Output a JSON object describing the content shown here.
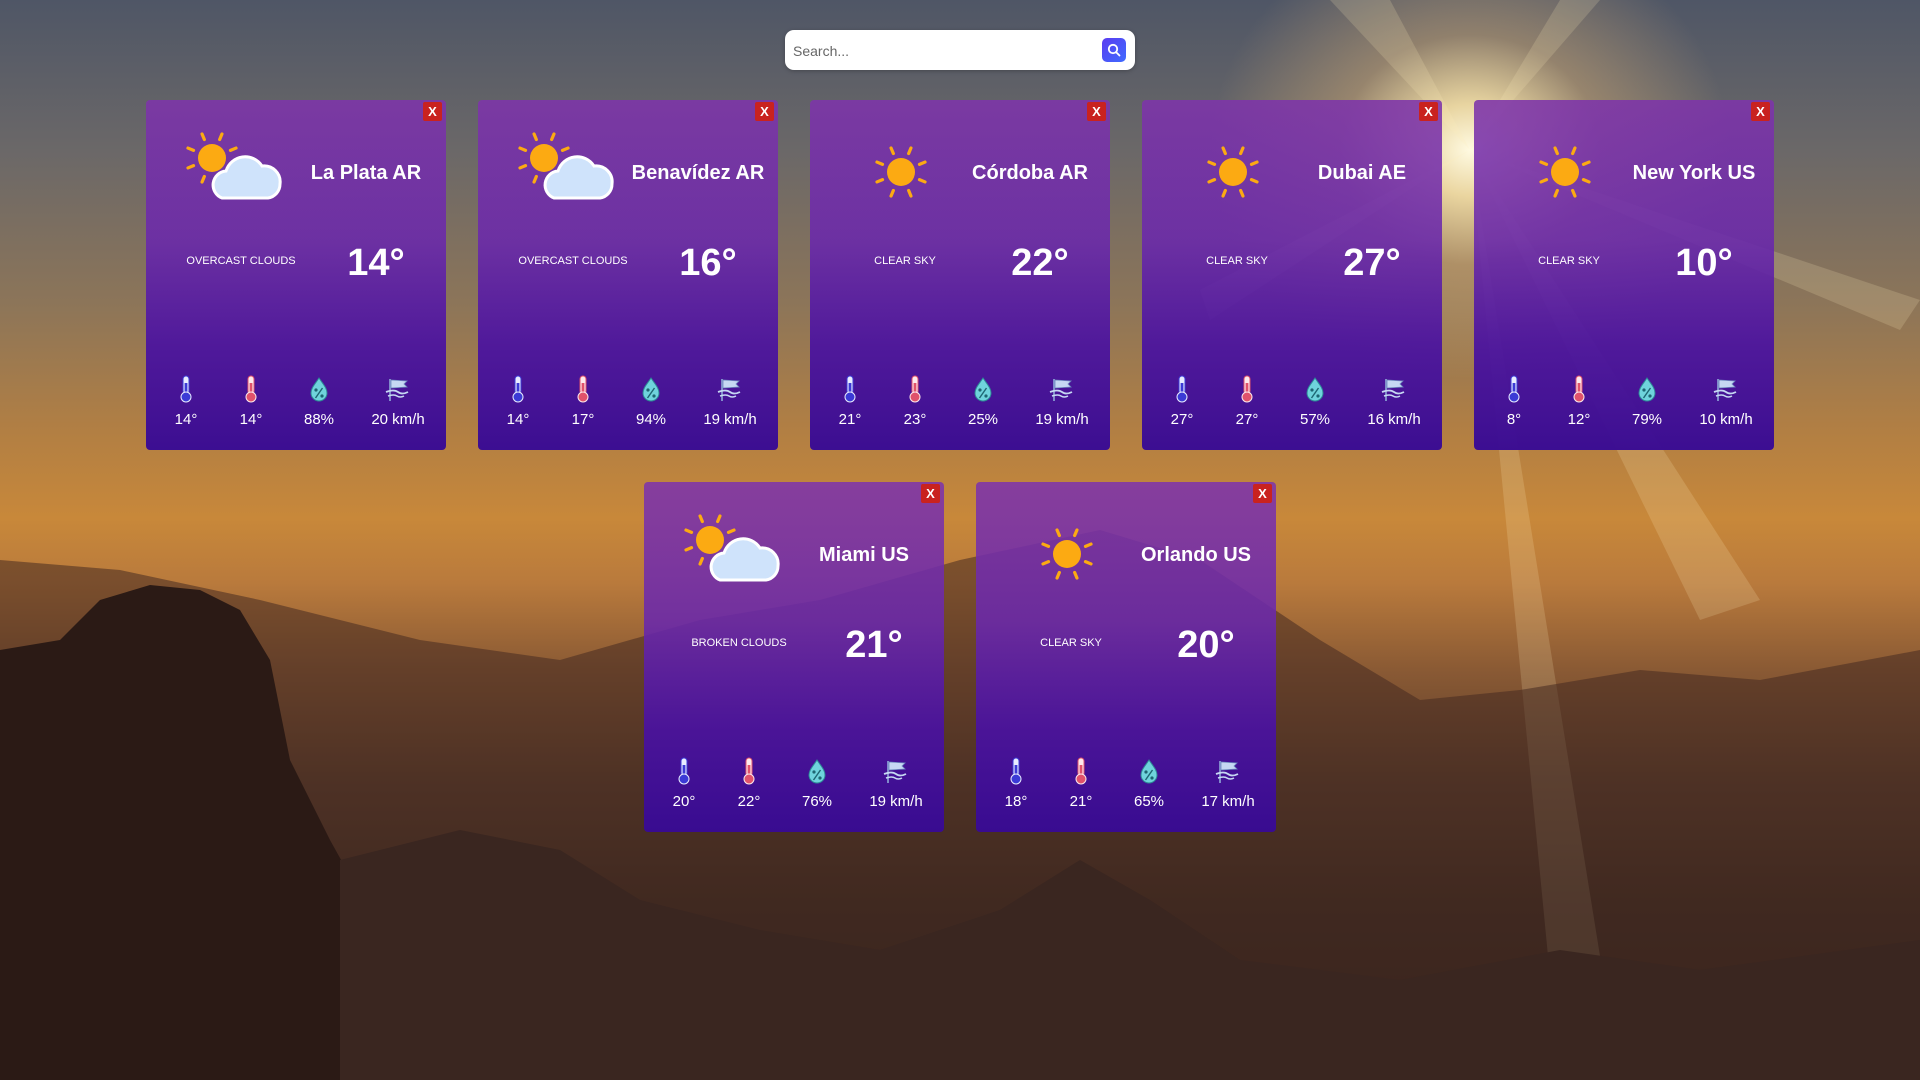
{
  "search": {
    "placeholder": "Search..."
  },
  "cards": [
    {
      "city": "La Plata AR",
      "description": "OVERCAST CLOUDS",
      "temp": "14°",
      "temp_min": "14°",
      "temp_max": "14°",
      "humidity": "88%",
      "wind": "20 km/h",
      "icon": "partly-cloudy-icon"
    },
    {
      "city": "Benavídez AR",
      "description": "OVERCAST CLOUDS",
      "temp": "16°",
      "temp_min": "14°",
      "temp_max": "17°",
      "humidity": "94%",
      "wind": "19 km/h",
      "icon": "partly-cloudy-icon"
    },
    {
      "city": "Córdoba AR",
      "description": "CLEAR SKY",
      "temp": "22°",
      "temp_min": "21°",
      "temp_max": "23°",
      "humidity": "25%",
      "wind": "19 km/h",
      "icon": "sun-icon"
    },
    {
      "city": "Dubai AE",
      "description": "CLEAR SKY",
      "temp": "27°",
      "temp_min": "27°",
      "temp_max": "27°",
      "humidity": "57%",
      "wind": "16 km/h",
      "icon": "sun-icon"
    },
    {
      "city": "New York US",
      "description": "CLEAR SKY",
      "temp": "10°",
      "temp_min": "8°",
      "temp_max": "12°",
      "humidity": "79%",
      "wind": "10 km/h",
      "icon": "sun-icon"
    },
    {
      "city": "Miami US",
      "description": "BROKEN CLOUDS",
      "temp": "21°",
      "temp_min": "20°",
      "temp_max": "22°",
      "humidity": "76%",
      "wind": "19 km/h",
      "icon": "partly-cloudy-icon"
    },
    {
      "city": "Orlando US",
      "description": "CLEAR SKY",
      "temp": "20°",
      "temp_min": "18°",
      "temp_max": "21°",
      "humidity": "65%",
      "wind": "17 km/h",
      "icon": "sun-icon"
    }
  ],
  "close_label": "X",
  "colors": {
    "close": "#c9221f",
    "sun": "#fcaa12",
    "cloud": "#cfe3fb"
  }
}
